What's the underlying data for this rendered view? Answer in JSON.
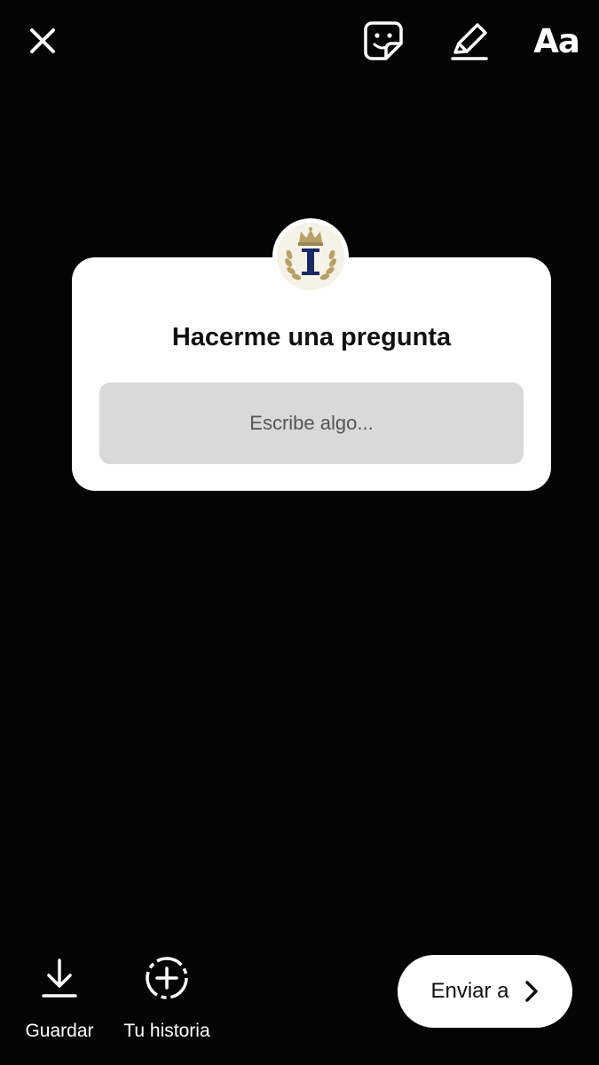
{
  "toolbar": {
    "close_icon": "close-icon",
    "sticker_icon": "sticker-icon",
    "draw_icon": "pen-icon",
    "text_label": "Aa"
  },
  "question_sticker": {
    "title": "Hacerme una pregunta",
    "placeholder": "Escribe algo...",
    "avatar_icon": "crest-logo"
  },
  "bottom_bar": {
    "save_label": "Guardar",
    "story_label": "Tu historia",
    "send_label": "Enviar a"
  },
  "colors": {
    "background": "#050404",
    "card": "#ffffff",
    "input": "#d9d9d9",
    "crest_blue": "#1c2a63",
    "crest_gold": "#b6a16a"
  }
}
